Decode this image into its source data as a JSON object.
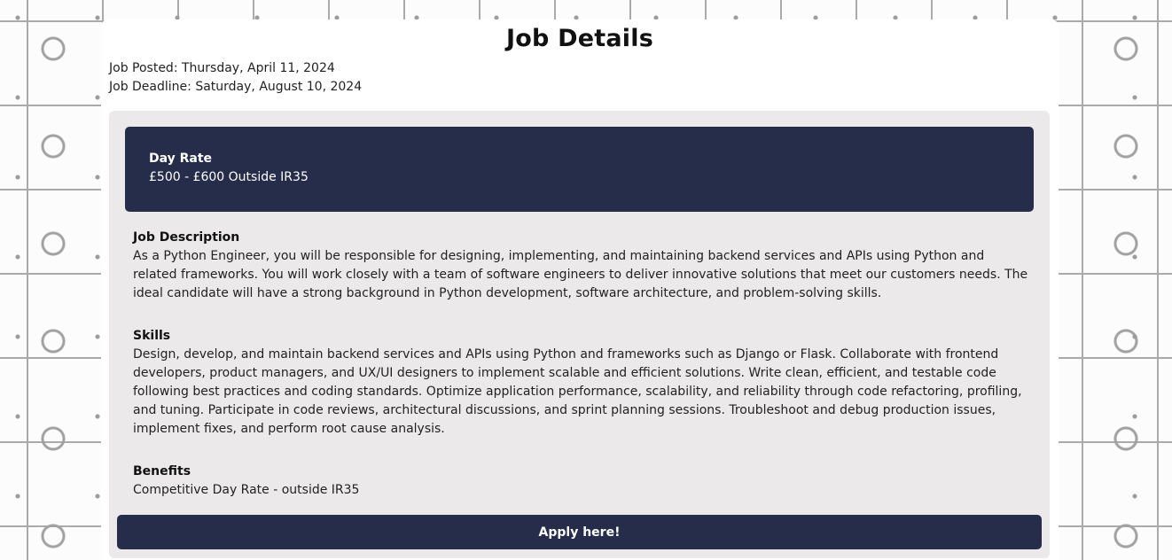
{
  "page": {
    "title": "Job Details",
    "posted": "Job Posted: Thursday, April 11, 2024",
    "deadline": "Job Deadline: Saturday, August 10, 2024"
  },
  "rate": {
    "label": "Day Rate",
    "value": "£500 - £600 Outside IR35"
  },
  "description": {
    "heading": "Job Description",
    "text": "As a Python Engineer, you will be responsible for designing, implementing, and maintaining backend services and APIs using Python and related frameworks. You will work closely with a team of software engineers to deliver innovative solutions that meet our customers needs. The ideal candidate will have a strong background in Python development, software architecture, and problem-solving skills."
  },
  "skills": {
    "heading": "Skills",
    "text": "Design, develop, and maintain backend services and APIs using Python and frameworks such as Django or Flask. Collaborate with frontend developers, product managers, and UX/UI designers to implement scalable and efficient solutions. Write clean, efficient, and testable code following best practices and coding standards. Optimize application performance, scalability, and reliability through code refactoring, profiling, and tuning. Participate in code reviews, architectural discussions, and sprint planning sessions. Troubleshoot and debug production issues, implement fixes, and perform root cause analysis."
  },
  "benefits": {
    "heading": "Benefits",
    "text": "Competitive Day Rate - outside IR35"
  },
  "apply_label": "Apply here!",
  "colors": {
    "accent": "#252d4a",
    "panel": "#ebe9ea"
  }
}
